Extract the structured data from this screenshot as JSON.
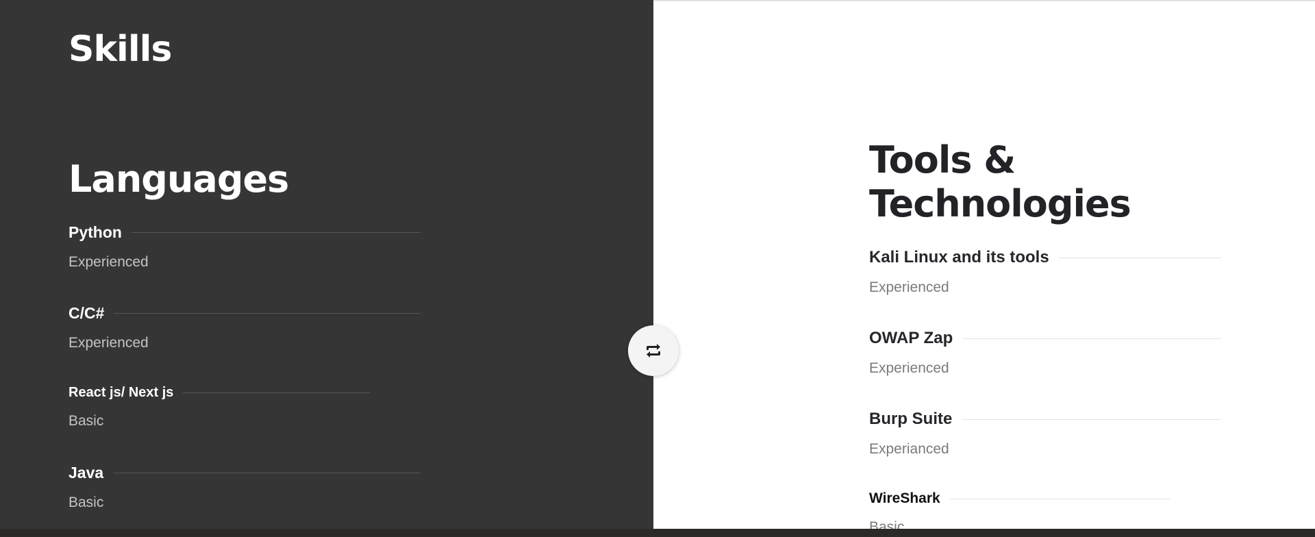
{
  "left": {
    "title": "Skills",
    "group_title": "Languages",
    "skills": [
      {
        "name": "Python",
        "level": "Experienced"
      },
      {
        "name": "C/C#",
        "level": "Experienced"
      },
      {
        "name": "React js/ Next js",
        "level": "Basic"
      },
      {
        "name": "Java",
        "level": "Basic"
      }
    ]
  },
  "right": {
    "group_title_line1": "Tools &",
    "group_title_line2": "Technologies",
    "skills": [
      {
        "name": "Kali Linux and its tools",
        "level": "Experienced"
      },
      {
        "name": "OWAP Zap",
        "level": "Experienced"
      },
      {
        "name": "Burp Suite",
        "level": "Experianced"
      },
      {
        "name": "WireShark",
        "level": "Basic"
      }
    ]
  },
  "toggle": {
    "icon": "swap-arrows-icon"
  },
  "colors": {
    "left_bg": "#353535",
    "right_bg": "#ffffff",
    "bottom_bar": "#2b2a27"
  }
}
